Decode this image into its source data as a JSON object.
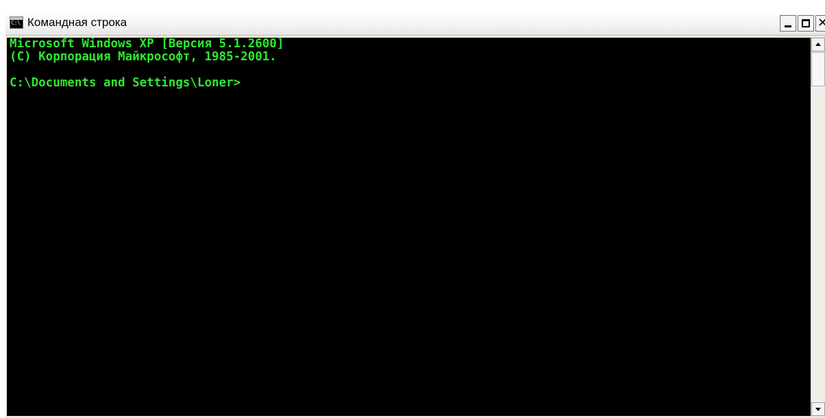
{
  "window": {
    "title": "Командная строка",
    "icon_text": "C:\\"
  },
  "console": {
    "lines": [
      "Microsoft Windows XP [Версия 5.1.2600]",
      "(С) Корпорация Майкрософт, 1985-2001.",
      "",
      "C:\\Documents and Settings\\Loner>"
    ],
    "text_color": "#2ee82e",
    "background_color": "#000000"
  },
  "title_buttons": {
    "close_glyph": "✕"
  },
  "icons": {
    "app": "command-prompt-icon",
    "minimize": "minimize-icon",
    "maximize": "maximize-icon",
    "close": "close-icon",
    "scroll_up": "arrow-up-icon",
    "scroll_down": "arrow-down-icon"
  }
}
